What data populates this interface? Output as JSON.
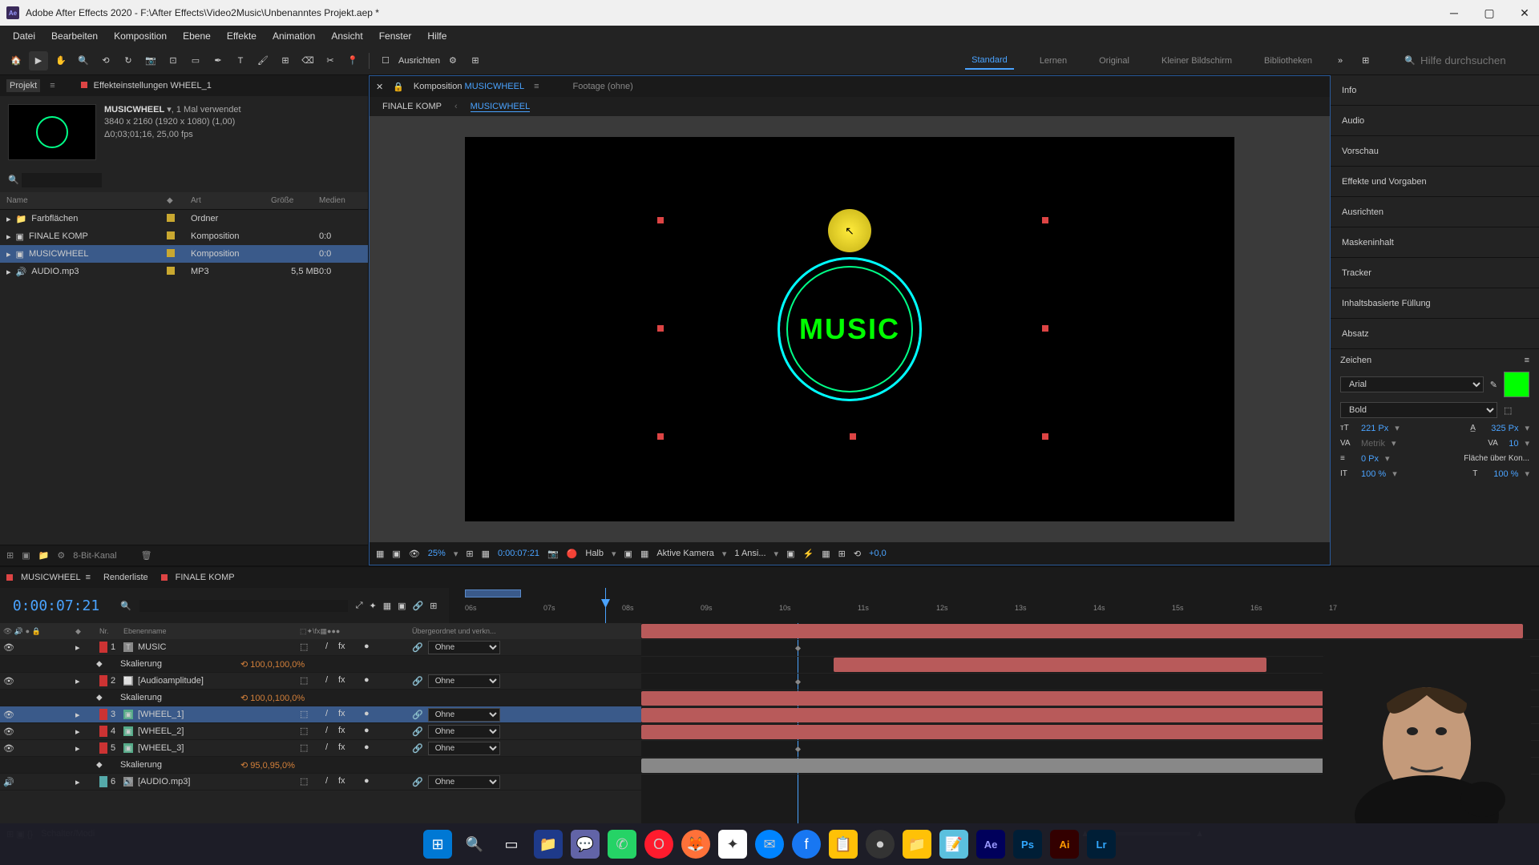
{
  "titlebar": {
    "app": "Ae",
    "title": "Adobe After Effects 2020 - F:\\After Effects\\Video2Music\\Unbenanntes Projekt.aep *"
  },
  "menu": [
    "Datei",
    "Bearbeiten",
    "Komposition",
    "Ebene",
    "Effekte",
    "Animation",
    "Ansicht",
    "Fenster",
    "Hilfe"
  ],
  "toolbar": {
    "align_label": "Ausrichten",
    "workspaces": [
      "Standard",
      "Lernen",
      "Original",
      "Kleiner Bildschirm",
      "Bibliotheken"
    ],
    "active_workspace": 0,
    "search_placeholder": "Hilfe durchsuchen"
  },
  "project": {
    "tab_project": "Projekt",
    "tab_effects": "Effekteinstellungen WHEEL_1",
    "selected_name": "MUSICWHEEL",
    "selected_usage": ", 1 Mal verwendet",
    "selected_dims": "3840 x 2160 (1920 x 1080) (1,00)",
    "selected_duration": "Δ0;03;01;16, 25,00 fps",
    "headers": {
      "name": "Name",
      "art": "Art",
      "size": "Größe",
      "media": "Medien"
    },
    "rows": [
      {
        "name": "Farbflächen",
        "art": "Ordner",
        "size": "",
        "media": "",
        "tag": "#c9a830",
        "icon": "folder"
      },
      {
        "name": "FINALE KOMP",
        "art": "Komposition",
        "size": "",
        "media": "0:0",
        "tag": "#c9a830",
        "icon": "comp"
      },
      {
        "name": "MUSICWHEEL",
        "art": "Komposition",
        "size": "",
        "media": "0:0",
        "tag": "#c9a830",
        "icon": "comp",
        "selected": true
      },
      {
        "name": "AUDIO.mp3",
        "art": "MP3",
        "size": "5,5 MB",
        "media": "0:0",
        "tag": "#c9a830",
        "icon": "audio"
      }
    ],
    "footer_label": "8-Bit-Kanal"
  },
  "comp": {
    "tab_comp_label": "Komposition",
    "tab_comp_name": "MUSICWHEEL",
    "tab_footage": "Footage (ohne)",
    "subtabs": {
      "finale": "FINALE KOMP",
      "music": "MUSICWHEEL"
    },
    "music_text": "MUSIC",
    "controls": {
      "zoom": "25%",
      "timecode": "0:00:07:21",
      "res": "Halb",
      "camera": "Aktive Kamera",
      "views": "1 Ansi...",
      "exposure": "+0,0"
    }
  },
  "right_panels": [
    "Info",
    "Audio",
    "Vorschau",
    "Effekte und Vorgaben",
    "Ausrichten",
    "Maskeninhalt",
    "Tracker",
    "Inhaltsbasierte Füllung",
    "Absatz"
  ],
  "char": {
    "title": "Zeichen",
    "font": "Arial",
    "weight": "Bold",
    "size": "221 Px",
    "leading": "325 Px",
    "kerning": "Metrik",
    "tracking": "10",
    "stroke": "0 Px",
    "stroke_mode": "Fläche über Kon...",
    "hscale": "100 %",
    "vscale": "100 %"
  },
  "timeline": {
    "tabs": {
      "active": "MUSICWHEEL",
      "render": "Renderliste",
      "finale": "FINALE KOMP"
    },
    "time": "0:00:07:21",
    "headers": {
      "nr": "Nr.",
      "name": "Ebenenname",
      "parent": "Übergeordnet und verkn..."
    },
    "parent_none": "Ohne",
    "scaling_label": "Skalierung",
    "layers": [
      {
        "nr": "1",
        "name": "MUSIC",
        "color": "#cc3333",
        "type": "text",
        "scale": "100,0,100,0%"
      },
      {
        "nr": "2",
        "name": "[Audioamplitude]",
        "color": "#cc3333",
        "type": "solid",
        "scale": "100,0,100,0%"
      },
      {
        "nr": "3",
        "name": "[WHEEL_1]",
        "color": "#cc3333",
        "type": "comp",
        "selected": true
      },
      {
        "nr": "4",
        "name": "[WHEEL_2]",
        "color": "#cc3333",
        "type": "comp"
      },
      {
        "nr": "5",
        "name": "[WHEEL_3]",
        "color": "#cc3333",
        "type": "comp",
        "scale": "95,0,95,0%"
      },
      {
        "nr": "6",
        "name": "[AUDIO.mp3]",
        "color": "#55aaaa",
        "type": "audio"
      }
    ],
    "ruler_ticks": [
      "06s",
      "07s",
      "08s",
      "09s",
      "10s",
      "11s",
      "12s",
      "13s",
      "14s",
      "15s",
      "16s",
      "17"
    ],
    "footer": "Schalter/Modi"
  },
  "taskbar_icons": [
    "win",
    "search",
    "tasks",
    "explorer",
    "chat",
    "whatsapp",
    "opera",
    "firefox",
    "app1",
    "messenger",
    "facebook",
    "app2",
    "obs",
    "folder",
    "notepad",
    "ae",
    "ps",
    "ai",
    "lr"
  ]
}
